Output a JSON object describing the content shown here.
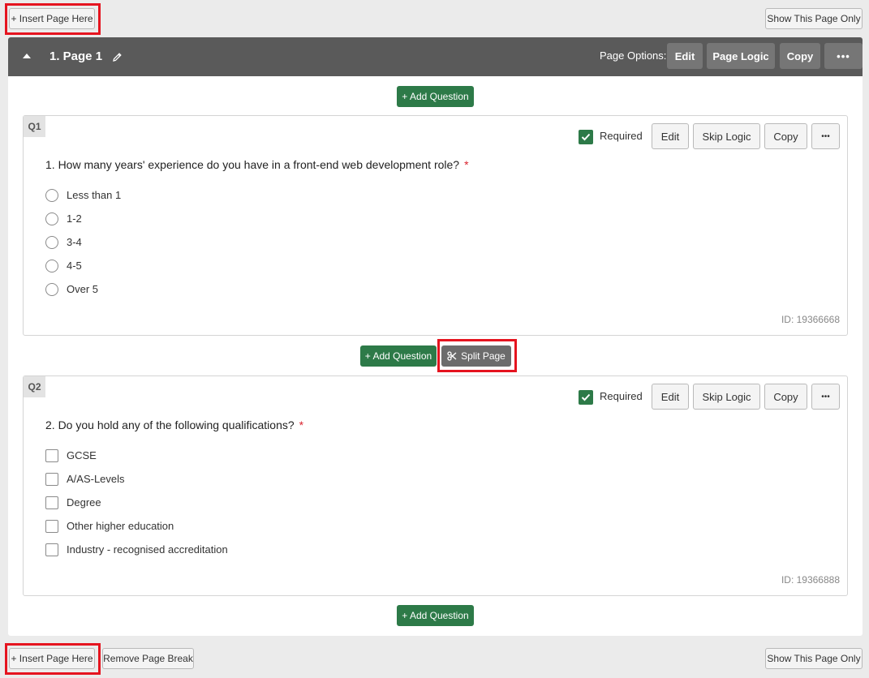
{
  "top_bar": {
    "insert_page_label": "+ Insert Page Here",
    "show_page_only_label": "Show This Page Only"
  },
  "page": {
    "title": "1. Page 1",
    "options_label": "Page Options:",
    "edit_label": "Edit",
    "page_logic_label": "Page Logic",
    "copy_label": "Copy",
    "more_label": "•••",
    "add_question_label": "+ Add Question",
    "split_page_label": "Split Page"
  },
  "questions": [
    {
      "badge": "Q1",
      "required_label": "Required",
      "edit_label": "Edit",
      "skip_logic_label": "Skip Logic",
      "copy_label": "Copy",
      "more_label": "•••",
      "text": "1. How many years' experience do you have in a front-end web development role?",
      "required_marker": "*",
      "input_type": "radio",
      "options": [
        "Less than 1",
        "1-2",
        "3-4",
        "4-5",
        "Over 5"
      ],
      "id_text": "ID: 19366668"
    },
    {
      "badge": "Q2",
      "required_label": "Required",
      "edit_label": "Edit",
      "skip_logic_label": "Skip Logic",
      "copy_label": "Copy",
      "more_label": "•••",
      "text": "2. Do you hold any of the following qualifications?",
      "required_marker": "*",
      "input_type": "checkbox",
      "options": [
        "GCSE",
        "A/AS-Levels",
        "Degree",
        "Other higher education",
        "Industry - recognised accreditation"
      ],
      "id_text": "ID: 19366888"
    }
  ],
  "bottom_bar": {
    "insert_page_label": "+ Insert Page Here",
    "remove_break_label": "Remove Page Break",
    "show_page_only_label": "Show This Page Only"
  },
  "colors": {
    "header_bg": "#5a5a5a",
    "green": "#2d7a48",
    "highlight_red": "#e5141f",
    "required_asterisk": "#d9232e"
  },
  "icons": {
    "collapse": "caret-up-icon",
    "rename": "pencil-icon",
    "split": "scissors-icon",
    "required": "check-icon"
  }
}
